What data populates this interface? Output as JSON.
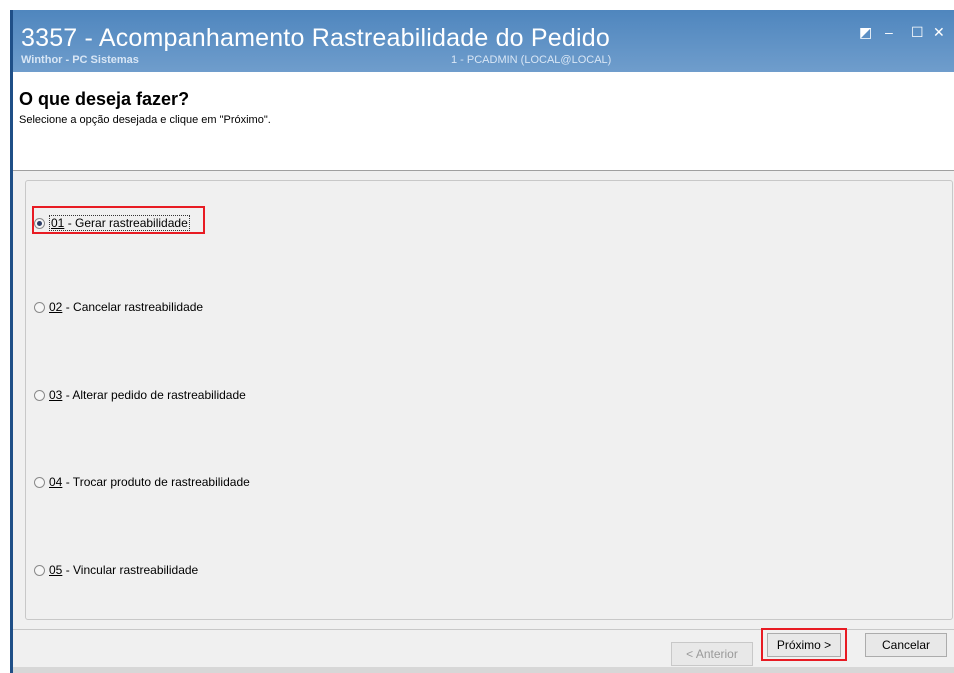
{
  "window": {
    "title": "3357 - Acompanhamento Rastreabilidade do Pedido",
    "subtitle": "Winthor - PC Sistemas",
    "user": "1 - PCADMIN (LOCAL@LOCAL)"
  },
  "controls": {
    "restore_glyph": "◩",
    "minimize_glyph": "–",
    "maximize_glyph": "☐",
    "close_glyph": "✕"
  },
  "wizard": {
    "heading": "O que deseja fazer?",
    "instruction": "Selecione a opção desejada e clique em \"Próximo\"."
  },
  "options": [
    {
      "code": "01",
      "label": " - Gerar rastreabilidade",
      "selected": true
    },
    {
      "code": "02",
      "label": " - Cancelar rastreabilidade",
      "selected": false
    },
    {
      "code": "03",
      "label": " - Alterar pedido de rastreabilidade",
      "selected": false
    },
    {
      "code": "04",
      "label": " - Trocar produto de rastreabilidade",
      "selected": false
    },
    {
      "code": "05",
      "label": " - Vincular rastreabilidade",
      "selected": false
    }
  ],
  "buttons": {
    "previous": "< Anterior",
    "next": "Próximo >",
    "cancel": "Cancelar"
  },
  "colors": {
    "highlight": "#e81b23",
    "titlebar": "#5b8fc4"
  }
}
